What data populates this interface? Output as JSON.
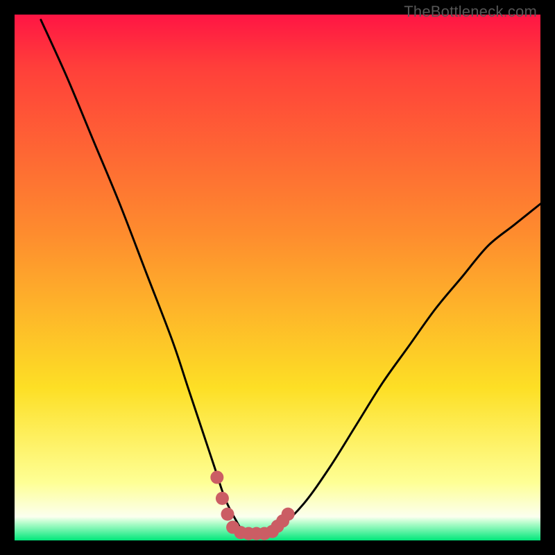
{
  "watermark": "TheBottleneck.com",
  "colors": {
    "top": "#ff1544",
    "mid_red": "#ff3f3a",
    "orange": "#fe8d2e",
    "yellow_high": "#fddf25",
    "yellow_pale": "#feff95",
    "near_white": "#fbffef",
    "green_start": "#c0fed1",
    "green_end": "#00e77a",
    "curve": "#000000",
    "markers": "#cb5d64"
  },
  "chart_data": {
    "type": "line",
    "title": "",
    "xlabel": "",
    "ylabel": "",
    "xlim": [
      0,
      100
    ],
    "ylim": [
      0,
      100
    ],
    "series": [
      {
        "name": "bottleneck-curve",
        "x": [
          5,
          10,
          15,
          20,
          25,
          30,
          33,
          36,
          38,
          40,
          42,
          44,
          46,
          48,
          50,
          55,
          60,
          65,
          70,
          75,
          80,
          85,
          90,
          95,
          100
        ],
        "y": [
          99,
          88,
          76,
          64,
          51,
          38,
          29,
          20,
          14,
          8,
          4,
          1,
          1,
          1,
          2,
          7,
          14,
          22,
          30,
          37,
          44,
          50,
          56,
          60,
          64
        ]
      }
    ],
    "markers": {
      "name": "bottom-cluster",
      "points": [
        {
          "x": 38.5,
          "y": 12
        },
        {
          "x": 39.5,
          "y": 8
        },
        {
          "x": 40.5,
          "y": 5
        },
        {
          "x": 41.5,
          "y": 2.5
        },
        {
          "x": 43,
          "y": 1.5
        },
        {
          "x": 44.5,
          "y": 1.3
        },
        {
          "x": 46,
          "y": 1.3
        },
        {
          "x": 47.5,
          "y": 1.3
        },
        {
          "x": 49,
          "y": 1.7
        },
        {
          "x": 50,
          "y": 2.7
        },
        {
          "x": 51,
          "y": 3.7
        },
        {
          "x": 52,
          "y": 5
        }
      ]
    },
    "gradient_stops": [
      {
        "offset": 0,
        "color_key": "top"
      },
      {
        "offset": 0.1,
        "color_key": "mid_red"
      },
      {
        "offset": 0.42,
        "color_key": "orange"
      },
      {
        "offset": 0.71,
        "color_key": "yellow_high"
      },
      {
        "offset": 0.89,
        "color_key": "yellow_pale"
      },
      {
        "offset": 0.955,
        "color_key": "near_white"
      },
      {
        "offset": 0.965,
        "color_key": "green_start"
      },
      {
        "offset": 1.0,
        "color_key": "green_end"
      }
    ]
  }
}
